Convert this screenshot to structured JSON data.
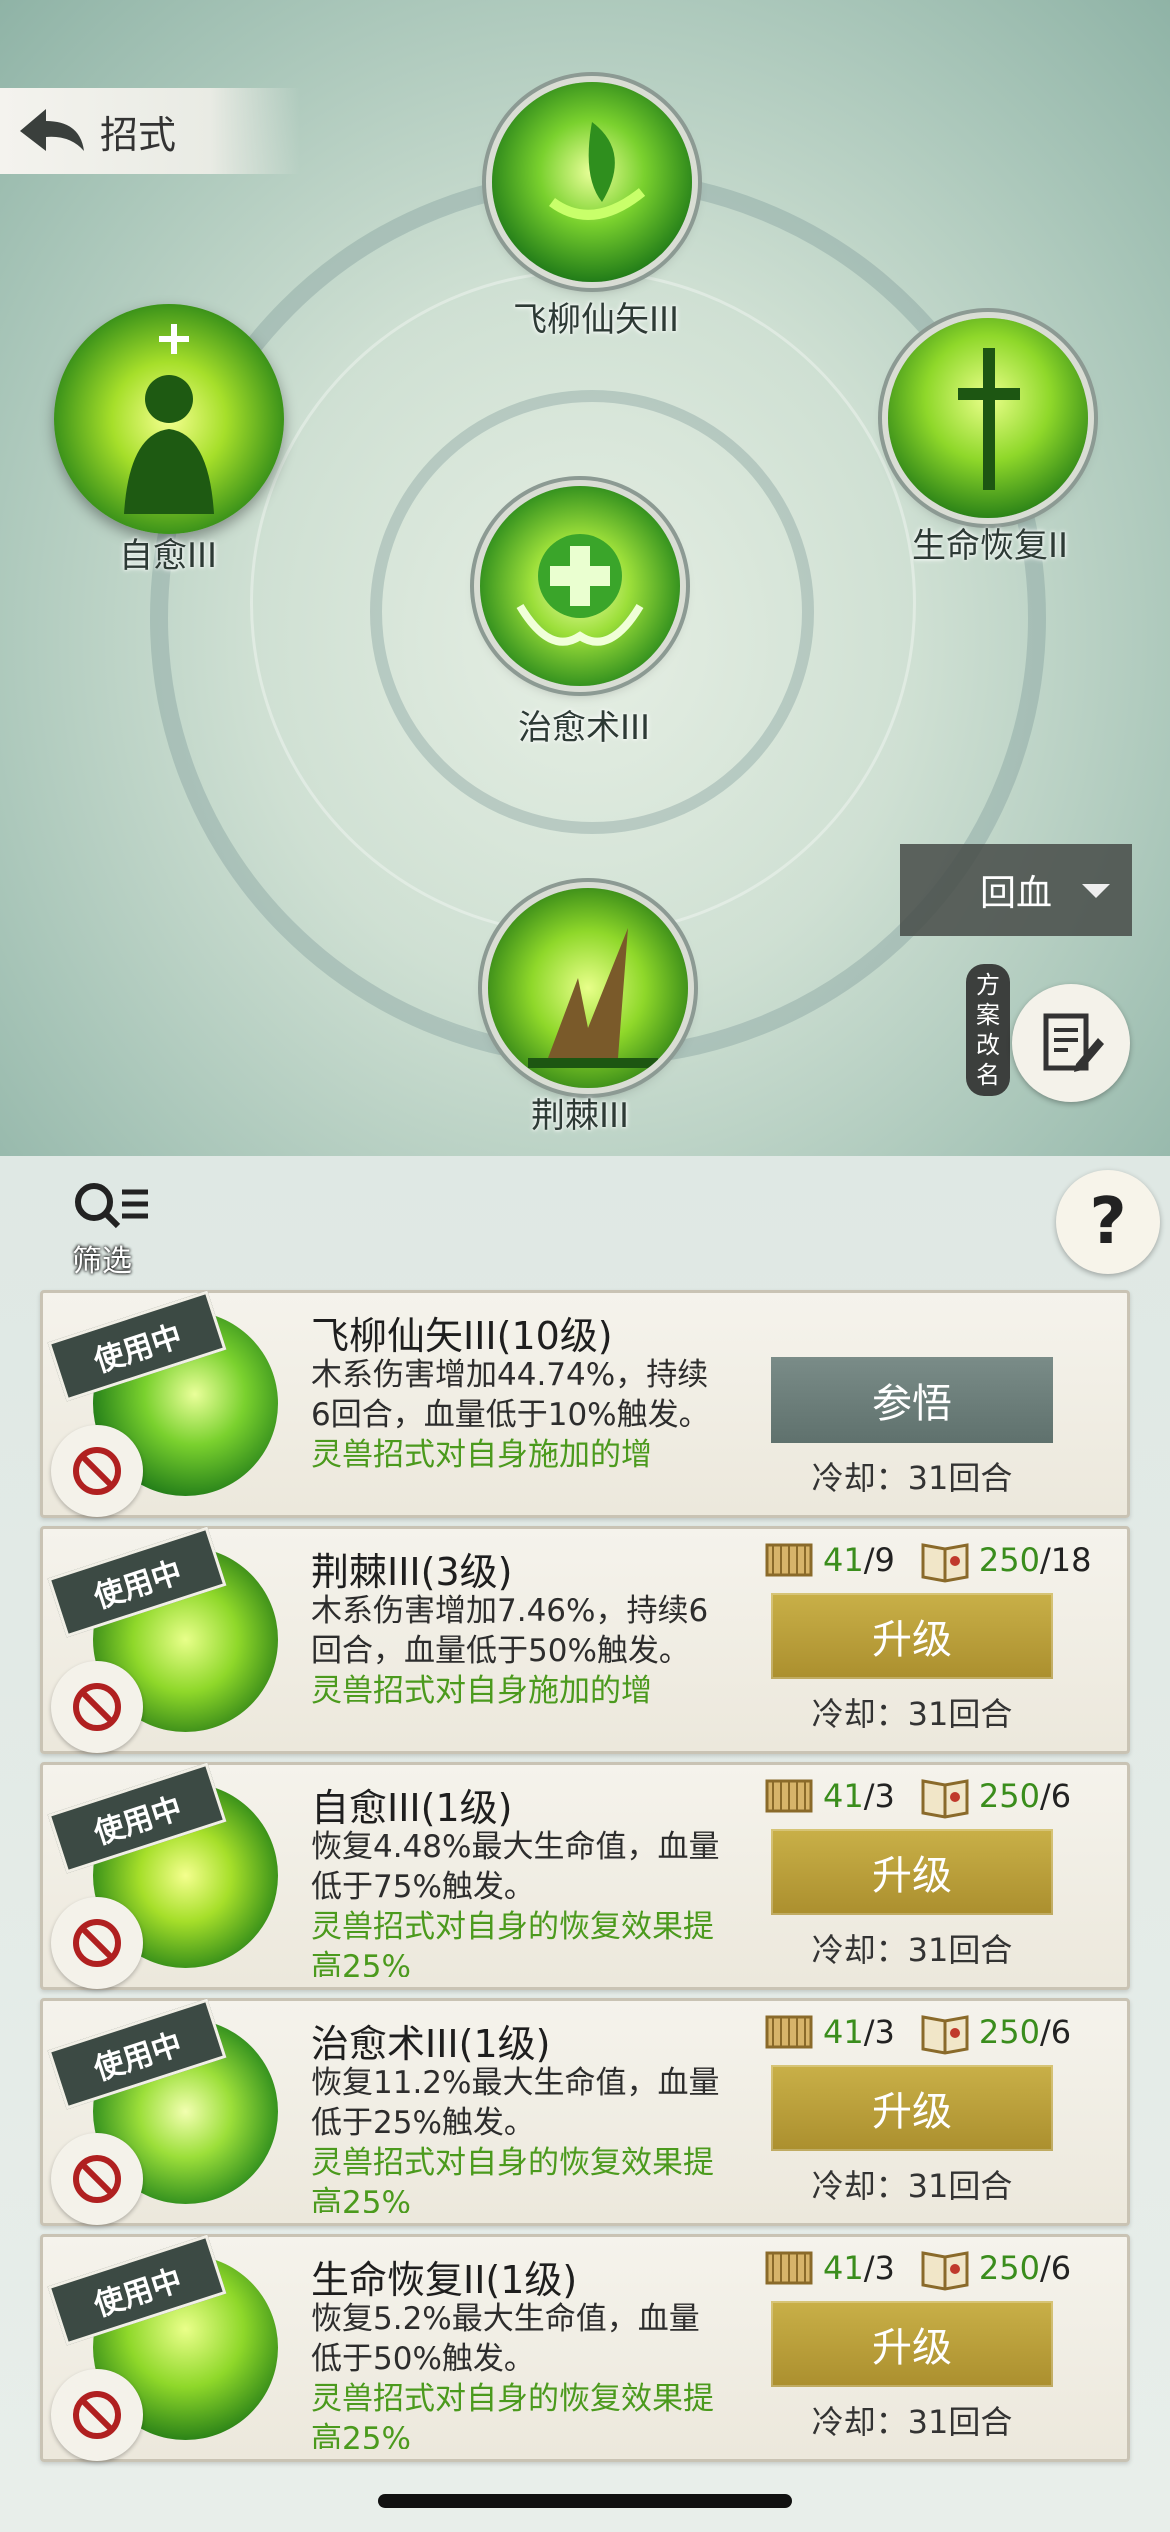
{
  "header": {
    "title": "招式",
    "back_icon": "back-arrow-icon"
  },
  "slots": {
    "top": "飞柳仙矢III",
    "left": "自愈III",
    "right": "生命恢复II",
    "center": "治愈术III",
    "bottom": "荆棘III"
  },
  "preset": {
    "selected": "回血"
  },
  "rename_label": [
    "方",
    "案",
    "改",
    "名"
  ],
  "filter_label": "筛选",
  "help_label": "?",
  "cards": [
    {
      "badge": "使用中",
      "name": "飞柳仙矢III(10级)",
      "desc": "木系伤害增加44.74%，持续6回合，血量低于10%触发。",
      "desc_green": "灵兽招式对自身施加的增",
      "button": "参悟",
      "cooldown": "冷却：31回合"
    },
    {
      "badge": "使用中",
      "name": "荆棘III(3级)",
      "desc": "木系伤害增加7.46%，持续6回合，血量低于50%触发。",
      "desc_green": "灵兽招式对自身施加的增",
      "mat1": "41",
      "mat1_req": "/9",
      "mat2": "250",
      "mat2_req": "/18",
      "button": "升级",
      "cooldown": "冷却：31回合"
    },
    {
      "badge": "使用中",
      "name": "自愈III(1级)",
      "desc": "恢复4.48%最大生命值，血量低于75%触发。",
      "desc_green": "灵兽招式对自身的恢复效果提高25%",
      "mat1": "41",
      "mat1_req": "/3",
      "mat2": "250",
      "mat2_req": "/6",
      "button": "升级",
      "cooldown": "冷却：31回合"
    },
    {
      "badge": "使用中",
      "name": "治愈术III(1级)",
      "desc": "恢复11.2%最大生命值，血量低于25%触发。",
      "desc_green": "灵兽招式对自身的恢复效果提高25%",
      "mat1": "41",
      "mat1_req": "/3",
      "mat2": "250",
      "mat2_req": "/6",
      "button": "升级",
      "cooldown": "冷却：31回合"
    },
    {
      "badge": "使用中",
      "name": "生命恢复II(1级)",
      "desc": "恢复5.2%最大生命值，血量低于50%触发。",
      "desc_green": "灵兽招式对自身的恢复效果提高25%",
      "mat1": "41",
      "mat1_req": "/3",
      "mat2": "250",
      "mat2_req": "/6",
      "button": "升级",
      "cooldown": "冷却：31回合"
    }
  ],
  "colors": {
    "accent_green": "#4b9a1d",
    "gold_button": "#bfa23c",
    "grey_button": "#6d7f7b"
  }
}
